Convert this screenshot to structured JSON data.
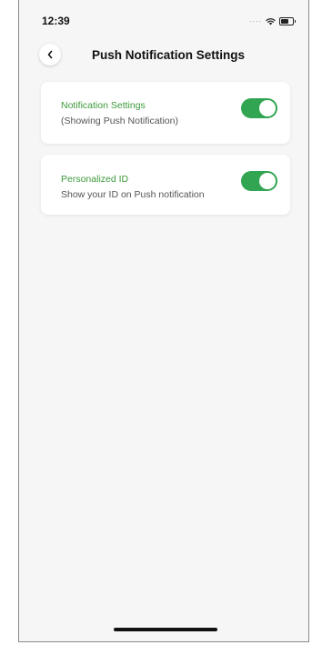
{
  "status_bar": {
    "time": "12:39"
  },
  "header": {
    "title": "Push Notification Settings",
    "back_icon": "chevron-left-icon"
  },
  "settings": [
    {
      "title": "Notification Settings",
      "subtitle": "(Showing Push Notification)",
      "enabled": true
    },
    {
      "title": "Personalized ID",
      "subtitle": "Show your ID on Push notification",
      "enabled": true
    }
  ],
  "colors": {
    "accent": "#31a552",
    "title_green": "#3c9a3a",
    "background": "#f6f6f7"
  }
}
